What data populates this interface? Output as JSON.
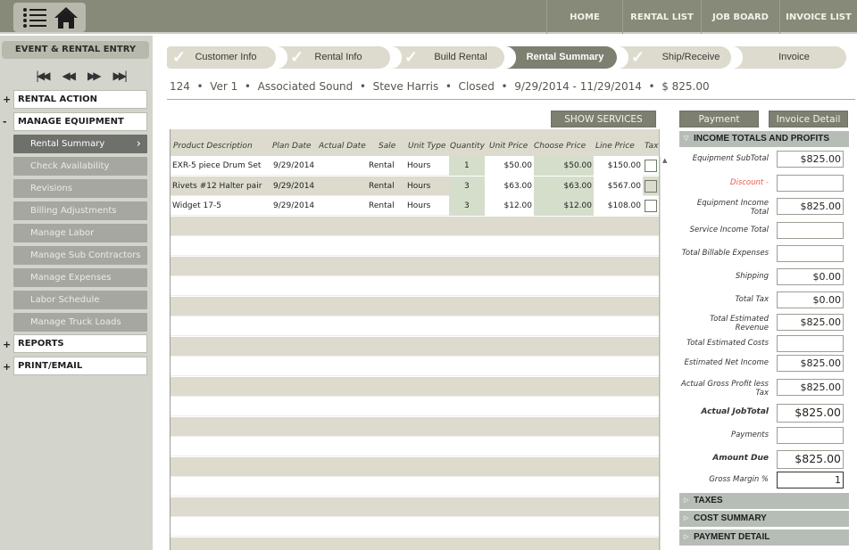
{
  "topbar": {
    "icons": [
      "list-icon",
      "home-icon"
    ],
    "nav": [
      "HOME",
      "RENTAL LIST",
      "JOB BOARD",
      "INVOICE LIST"
    ]
  },
  "sidebar": {
    "header": "EVENT & RENTAL ENTRY",
    "record_nav": [
      "⏮",
      "⏪",
      "⏩",
      "⏭"
    ],
    "sections": [
      {
        "sign": "+",
        "label": "RENTAL ACTION"
      },
      {
        "sign": "-",
        "label": "MANAGE EQUIPMENT"
      },
      {
        "sign": "+",
        "label": "REPORTS"
      },
      {
        "sign": "+",
        "label": "PRINT/EMAIL"
      }
    ],
    "items": [
      {
        "label": "Rental Summary",
        "active": true
      },
      {
        "label": "Check Availability"
      },
      {
        "label": "Revisions"
      },
      {
        "label": "Billing Adjustments"
      },
      {
        "label": "Manage Labor"
      },
      {
        "label": "Manage Sub Contractors"
      },
      {
        "label": "Manage Expenses"
      },
      {
        "label": "Labor Schedule"
      },
      {
        "label": "Manage Truck Loads"
      }
    ]
  },
  "steps": [
    {
      "label": "Customer Info",
      "checked": true
    },
    {
      "label": "Rental Info",
      "checked": true
    },
    {
      "label": "Build Rental",
      "checked": true
    },
    {
      "label": "Rental Summary",
      "active": true
    },
    {
      "label": "Ship/Receive",
      "checked": true
    },
    {
      "label": "Invoice"
    }
  ],
  "info_line": "124  •  Ver 1  •  Associated Sound  •  Steve Harris  •  Closed  •  9/29/2014 - 11/29/2014  •  $ 825.00",
  "show_services_label": "SHOW SERVICES",
  "table": {
    "columns": [
      "Product Description",
      "Plan Date",
      "Actual Date",
      "Sale",
      "Unit Type",
      "Quantity",
      "Unit Price",
      "Choose Price",
      "Line Price",
      "Tax"
    ],
    "rows": [
      {
        "description": "EXR-5 piece Drum Set",
        "plan_date": "9/29/2014",
        "actual_date": "",
        "sale": "Rental",
        "unit_type": "Hours",
        "quantity": "1",
        "unit_price": "$50.00",
        "choose_price": "$50.00",
        "line_price": "$150.00",
        "tax": false
      },
      {
        "description": "Rivets #12 Halter pair",
        "plan_date": "9/29/2014",
        "actual_date": "",
        "sale": "Rental",
        "unit_type": "Hours",
        "quantity": "3",
        "unit_price": "$63.00",
        "choose_price": "$63.00",
        "line_price": "$567.00",
        "tax": false
      },
      {
        "description": "Widget 17-5",
        "plan_date": "9/29/2014",
        "actual_date": "",
        "sale": "Rental",
        "unit_type": "Hours",
        "quantity": "3",
        "unit_price": "$12.00",
        "choose_price": "$12.00",
        "line_price": "$108.00",
        "tax": false
      }
    ]
  },
  "right_panel": {
    "payment_label": "Payment",
    "invoice_detail_label": "Invoice Detail",
    "income_header": "INCOME TOTALS AND PROFITS",
    "fields": [
      {
        "label": "Equipment SubTotal",
        "value": "$825.00"
      },
      {
        "label": "Discount -",
        "value": "",
        "style": "red"
      },
      {
        "label": "Equipment Income Total",
        "value": "$825.00"
      },
      {
        "label": "Service Income Total",
        "value": ""
      },
      {
        "label": "Total Billable Expenses",
        "value": ""
      },
      {
        "label": "Shipping",
        "value": "$0.00"
      },
      {
        "label": "Total Tax",
        "value": "$0.00"
      },
      {
        "label": "Total Estimated Revenue",
        "value": "$825.00"
      },
      {
        "label": "Total Estimated Costs",
        "value": ""
      },
      {
        "label": "Estimated Net Income",
        "value": "$825.00"
      },
      {
        "label": "Actual Gross Profit less Tax",
        "value": "$825.00"
      },
      {
        "label": "Actual JobTotal",
        "value": "$825.00",
        "style": "bold"
      },
      {
        "label": "Payments",
        "value": ""
      },
      {
        "label": "Amount Due",
        "value": "$825.00",
        "style": "bold"
      },
      {
        "label": "Gross Margin %",
        "value": "1"
      }
    ],
    "collapsed_sections": [
      "TAXES",
      "COST SUMMARY",
      "PAYMENT DETAIL"
    ]
  }
}
